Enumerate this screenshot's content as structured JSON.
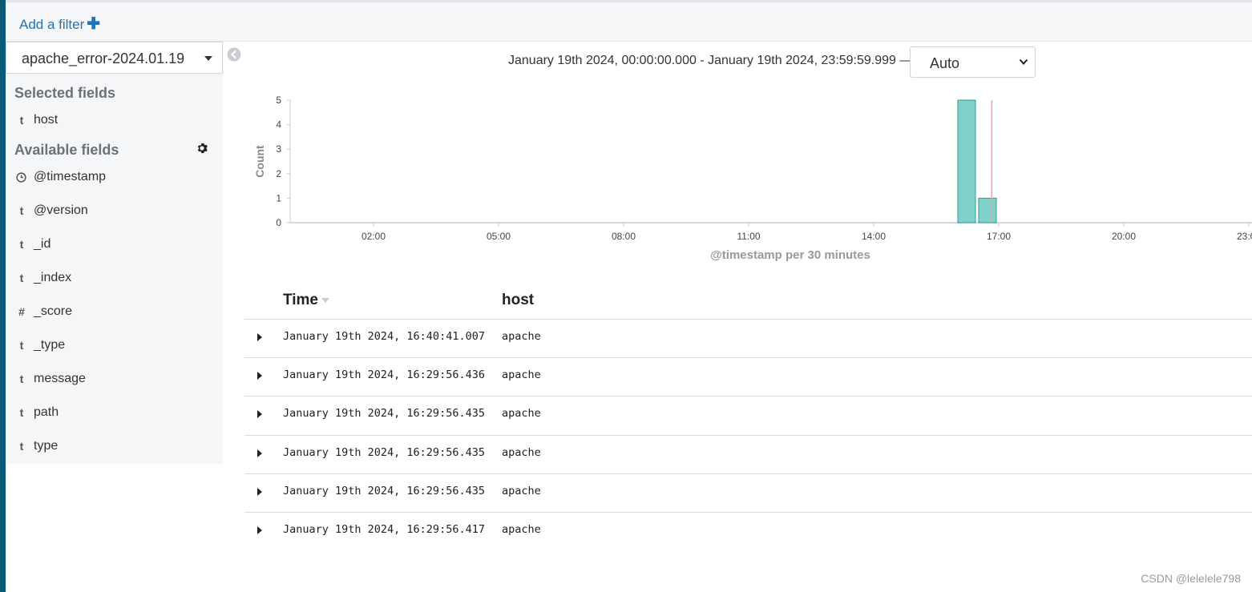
{
  "filter_bar": {
    "add_filter_label": "Add a filter",
    "add_icon": "plus-icon"
  },
  "sidebar": {
    "index_pattern": "apache_error-2024.01.19",
    "selected_title": "Selected fields",
    "selected_fields": [
      {
        "type": "t",
        "name": "host"
      }
    ],
    "available_title": "Available fields",
    "available_fields": [
      {
        "type": "clock",
        "name": "@timestamp"
      },
      {
        "type": "t",
        "name": "@version"
      },
      {
        "type": "t",
        "name": "_id"
      },
      {
        "type": "t",
        "name": "_index"
      },
      {
        "type": "#",
        "name": "_score"
      },
      {
        "type": "t",
        "name": "_type"
      },
      {
        "type": "t",
        "name": "message"
      },
      {
        "type": "t",
        "name": "path"
      },
      {
        "type": "t",
        "name": "type"
      }
    ]
  },
  "header": {
    "time_range": "January 19th 2024, 00:00:00.000 - January 19th 2024, 23:59:59.999 —",
    "interval": "Auto"
  },
  "chart_data": {
    "type": "bar",
    "ylabel": "Count",
    "xlabel": "@timestamp per 30 minutes",
    "ylim": [
      0,
      5
    ],
    "y_ticks": [
      "0",
      "1",
      "2",
      "3",
      "4",
      "5"
    ],
    "x_ticks": [
      "02:00",
      "05:00",
      "08:00",
      "11:00",
      "14:00",
      "17:00",
      "20:00",
      "23:00"
    ],
    "x_tick_hours": [
      2,
      5,
      8,
      11,
      14,
      17,
      20,
      23
    ],
    "bars": [
      {
        "start": "16:00",
        "value": 5
      },
      {
        "start": "16:30",
        "value": 1
      }
    ],
    "current_time_marker": "16:50",
    "bar_color": "#7fd2c9",
    "marker_color": "#f19da6"
  },
  "table": {
    "columns": [
      "Time",
      "host"
    ],
    "rows": [
      {
        "time": "January 19th 2024, 16:40:41.007",
        "host": "apache"
      },
      {
        "time": "January 19th 2024, 16:29:56.436",
        "host": "apache"
      },
      {
        "time": "January 19th 2024, 16:29:56.435",
        "host": "apache"
      },
      {
        "time": "January 19th 2024, 16:29:56.435",
        "host": "apache"
      },
      {
        "time": "January 19th 2024, 16:29:56.435",
        "host": "apache"
      },
      {
        "time": "January 19th 2024, 16:29:56.417",
        "host": "apache"
      }
    ]
  },
  "watermark": "CSDN @lelelele798"
}
